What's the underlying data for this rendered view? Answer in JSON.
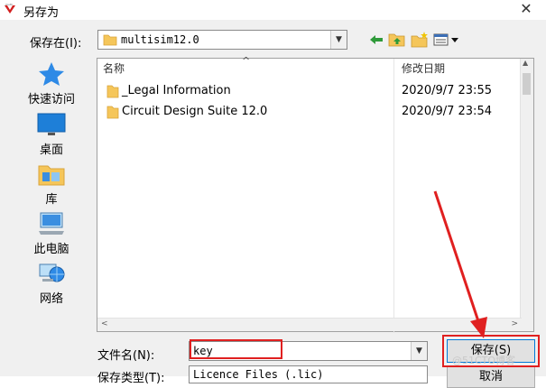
{
  "window": {
    "title": "另存为",
    "close_glyph": "✕"
  },
  "location": {
    "label": "保存在(I):",
    "value": "multisim12.0"
  },
  "toolbar": {
    "icons": [
      "back-arrow-icon",
      "up-folder-icon",
      "new-folder-icon",
      "view-menu-icon"
    ]
  },
  "places": [
    {
      "label": "快速访问",
      "icon": "star-icon"
    },
    {
      "label": "桌面",
      "icon": "desktop-icon"
    },
    {
      "label": "库",
      "icon": "library-icon"
    },
    {
      "label": "此电脑",
      "icon": "computer-icon"
    },
    {
      "label": "网络",
      "icon": "network-icon"
    }
  ],
  "filelist": {
    "columns": {
      "name": "名称",
      "date": "修改日期"
    },
    "rows": [
      {
        "name": "_Legal Information",
        "date": "2020/9/7 23:55"
      },
      {
        "name": "Circuit Design Suite 12.0",
        "date": "2020/9/7 23:54"
      }
    ]
  },
  "filename": {
    "label": "文件名(N):",
    "value": "key"
  },
  "filetype": {
    "label": "保存类型(T):",
    "value": "Licence Files (.lic)"
  },
  "buttons": {
    "save": "保存(S)",
    "cancel": "取消"
  },
  "annotation": {
    "color": "#e02020"
  },
  "watermark": "@51CTO博客"
}
